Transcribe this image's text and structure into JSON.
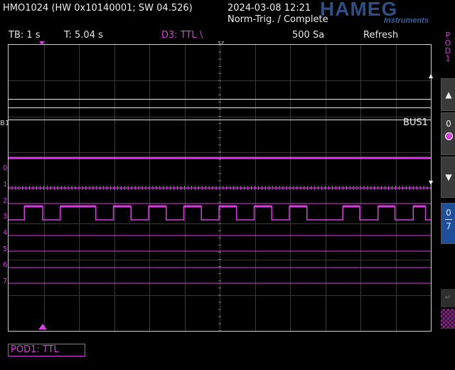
{
  "header": {
    "device": "HMO1024 (HW 0x10140001; SW 04.526)",
    "datetime": "2024-03-08 12:21",
    "trigger_status": "Norm-Trig. / Complete",
    "logo": "HAMEG",
    "logo_sub": "Instruments"
  },
  "status_bar": {
    "timebase": "TB: 1 s",
    "trigger_time": "T: 5.04 s",
    "trigger_source": "D3: TTL \\",
    "sample_rate": "500 Sa",
    "mode": "Refresh"
  },
  "channel_labels": [
    "0",
    "1",
    "2",
    "3",
    "4",
    "5",
    "6",
    "7"
  ],
  "bus_marker": "B1",
  "bus_label": "BUS1",
  "side_panel": {
    "pod_label": "POD1",
    "up_arrow": "▲",
    "position_zero": "0",
    "down_arrow": "▼",
    "range_top": "0",
    "range_bottom": "7"
  },
  "pod_setting": "POD1: TTL",
  "colors": {
    "digital": "#d63fe0",
    "bus": "#e8e8e8",
    "grid": "#3a3a3a",
    "accent_blue": "#1f4f9a"
  },
  "channel_3_pulses": [
    {
      "start": 0.45,
      "end": 0.97
    },
    {
      "start": 1.47,
      "end": 2.48
    },
    {
      "start": 2.98,
      "end": 3.48
    },
    {
      "start": 3.98,
      "end": 4.48
    },
    {
      "start": 4.98,
      "end": 5.48
    },
    {
      "start": 5.98,
      "end": 6.48
    },
    {
      "start": 6.98,
      "end": 7.48
    },
    {
      "start": 7.98,
      "end": 8.48
    },
    {
      "start": 9.5,
      "end": 9.98
    },
    {
      "start": 10.5,
      "end": 10.98
    },
    {
      "start": 11.5,
      "end": 11.85
    }
  ]
}
